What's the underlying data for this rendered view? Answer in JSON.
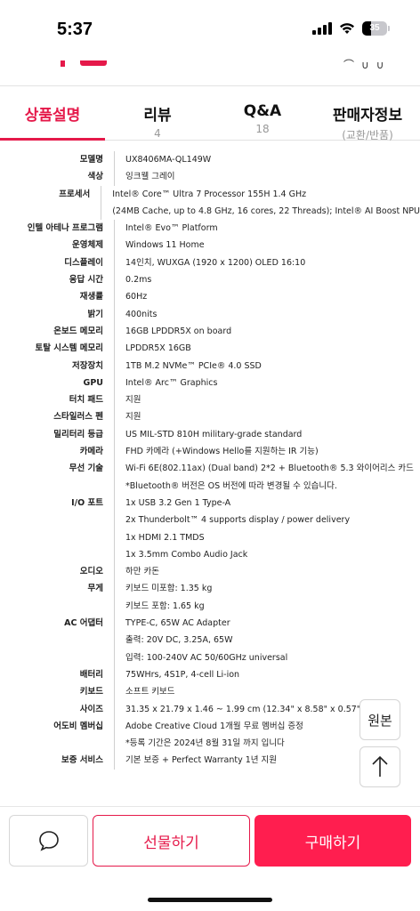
{
  "status_bar": {
    "time": "5:37",
    "battery_level": "35",
    "battery_fraction": 0.35,
    "icons": [
      "cellular-signal-icon",
      "wifi-icon",
      "battery-icon"
    ]
  },
  "header_icons": [
    "search-icon",
    "cart-icon"
  ],
  "tabs": [
    {
      "label": "상품설명",
      "sub": "",
      "active": true
    },
    {
      "label": "리뷰",
      "sub": "4",
      "active": false
    },
    {
      "label": "Q&A",
      "sub": "18",
      "active": false
    },
    {
      "label": "판매자정보",
      "sub": "(교환/반품)",
      "active": false
    }
  ],
  "specs": [
    {
      "label": "모델명",
      "values": [
        "UX8406MA-QL149W"
      ]
    },
    {
      "label": "색상",
      "values": [
        "잉크웰 그레이"
      ]
    },
    {
      "label": "프로세서",
      "values": [
        "Intel® Core™ Ultra 7 Processor 155H 1.4 GHz",
        "(24MB Cache, up to 4.8 GHz, 16 cores, 22 Threads); Intel® AI Boost NPU"
      ]
    },
    {
      "label": "인텔 아테나 프로그램",
      "values": [
        "Intel® Evo™ Platform"
      ]
    },
    {
      "label": "운영체제",
      "values": [
        "Windows 11 Home"
      ]
    },
    {
      "label": "디스플레이",
      "values": [
        "14인치, WUXGA (1920 x 1200) OLED 16:10"
      ]
    },
    {
      "label": "응답 시간",
      "values": [
        "0.2ms"
      ]
    },
    {
      "label": "재생률",
      "values": [
        "60Hz"
      ]
    },
    {
      "label": "밝기",
      "values": [
        "400nits"
      ]
    },
    {
      "label": "온보드 메모리",
      "values": [
        "16GB LPDDR5X on board"
      ]
    },
    {
      "label": "토탈 시스템 메모리",
      "values": [
        "LPDDR5X 16GB"
      ]
    },
    {
      "label": "저장장치",
      "values": [
        "1TB M.2 NVMe™ PCIe® 4.0 SSD"
      ]
    },
    {
      "label": "GPU",
      "values": [
        "Intel® Arc™ Graphics"
      ]
    },
    {
      "label": "터치 패드",
      "values": [
        "지원"
      ]
    },
    {
      "label": "스타일러스 펜",
      "values": [
        "지원"
      ]
    },
    {
      "label": "밀리터리 등급",
      "values": [
        "US MIL-STD 810H military-grade standard"
      ]
    },
    {
      "label": "카메라",
      "values": [
        "FHD 카메라 (+Windows Hello를 지원하는 IR 기능)"
      ]
    },
    {
      "label": "무선 기술",
      "values": [
        "Wi-Fi 6E(802.11ax) (Dual band) 2*2 + Bluetooth® 5.3 와이어리스 카드",
        "*Bluetooth® 버전은 OS 버전에 따라 변경될 수 있습니다."
      ]
    },
    {
      "label": "I/O 포트",
      "values": [
        "1x USB 3.2 Gen 1 Type-A",
        "2x Thunderbolt™ 4 supports display / power delivery",
        "1x HDMI 2.1 TMDS",
        "1x 3.5mm Combo Audio Jack"
      ]
    },
    {
      "label": "오디오",
      "values": [
        "하만 카돈"
      ]
    },
    {
      "label": "무게",
      "values": [
        "키보드 미포함: 1.35 kg",
        "키보드 포함: 1.65 kg"
      ]
    },
    {
      "label": "AC 어댑터",
      "values": [
        "TYPE-C, 65W AC Adapter",
        "출력: 20V DC, 3.25A, 65W",
        "입력: 100-240V AC 50/60GHz universal"
      ]
    },
    {
      "label": "배터리",
      "values": [
        "75WHrs, 4S1P, 4-cell Li-ion"
      ]
    },
    {
      "label": "키보드",
      "values": [
        "소프트 키보드"
      ]
    },
    {
      "label": "사이즈",
      "values": [
        "31.35 x 21.79 x 1.46 ~ 1.99 cm (12.34\" x 8.58\" x 0.57\" ~ 0.78\")"
      ]
    },
    {
      "label": "어도비 멤버십",
      "values": [
        "Adobe Creative Cloud 1개월 무료 멤버십 증정",
        "*등록 기간은 2024년 8월 31일 까지 입니다"
      ]
    },
    {
      "label": "보증 서비스",
      "values": [
        "기본 보증 + Perfect Warranty 1년 지원"
      ]
    }
  ],
  "floating": {
    "original_label": "원본",
    "top_icon": "arrow-up-icon"
  },
  "bottom_bar": {
    "chat_icon": "chat-bubble-icon",
    "gift_label": "선물하기",
    "buy_label": "구매하기"
  },
  "colors": {
    "accent": "#e5194a",
    "buy_button": "#ff1e4f"
  }
}
